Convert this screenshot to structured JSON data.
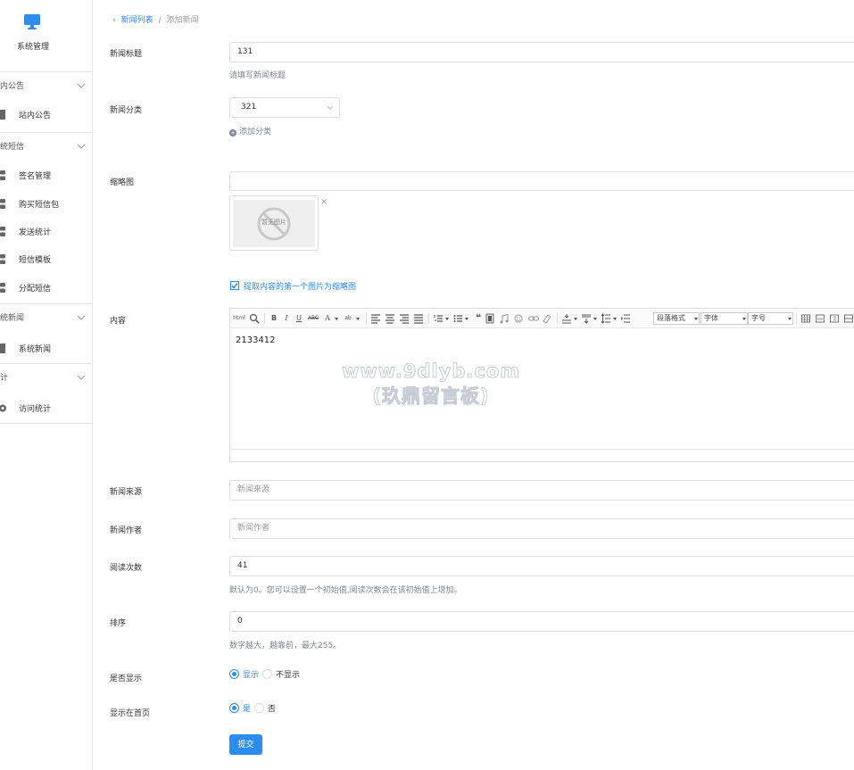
{
  "sidebar": {
    "brand_label": "系统管理",
    "groups": [
      {
        "title": "内公告",
        "items": [
          "站内公告"
        ]
      },
      {
        "title": "统短信",
        "items": [
          "签名管理",
          "购买短信包",
          "发送统计",
          "短信模板",
          "分配短信"
        ]
      },
      {
        "title": "统新闻",
        "items": [
          "系统新闻"
        ]
      },
      {
        "title": "计",
        "items": [
          "访问统计"
        ]
      }
    ]
  },
  "breadcrumb": {
    "back_icon": "‹",
    "parent": "新闻列表",
    "separator": "/",
    "current": "添加新闻"
  },
  "form": {
    "title_label": "新闻标题",
    "title_value": "131",
    "title_hint": "请填写新闻标题",
    "category_label": "新闻分类",
    "category_value": "321",
    "add_category": "添加分类",
    "thumb_label": "缩略图",
    "thumb_placeholder_text": "暂无图片",
    "thumb_delete": "×",
    "extract_checkbox_label": "提取内容的第一个图片为缩略图",
    "content_label": "内容",
    "content_text": "2133412",
    "source_label": "新闻来源",
    "source_placeholder": "新闻来源",
    "author_label": "新闻作者",
    "author_placeholder": "新闻作者",
    "reads_label": "阅读次数",
    "reads_value": "41",
    "reads_hint": "默认为0。您可以设置一个初始值,阅读次数会在该初始值上增加。",
    "sort_label": "排序",
    "sort_value": "0",
    "sort_hint": "数字越大，越靠前，最大255。",
    "show_label": "是否显示",
    "show_yes": "显示",
    "show_no": "不显示",
    "home_label": "显示在首页",
    "home_yes": "是",
    "home_no": "否",
    "submit": "提交"
  },
  "editor": {
    "paragraph_format": "段落格式",
    "font_family": "字体",
    "font_size": "字号",
    "buttons": [
      "html",
      "B",
      "I",
      "U",
      "ABC",
      "A",
      "ab"
    ]
  },
  "watermark": {
    "line1": "www.9dlyb.com",
    "line2": "(玖鼎留言板)"
  },
  "colors": {
    "accent": "#2d8cf0",
    "border": "#dcdee2",
    "muted": "#808695"
  }
}
